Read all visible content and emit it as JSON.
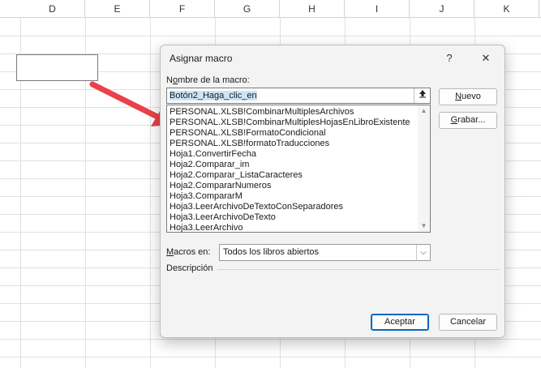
{
  "sheet": {
    "columns": [
      "D",
      "E",
      "F",
      "G",
      "H",
      "I",
      "J",
      "K"
    ]
  },
  "dialog": {
    "title": "Asignar macro",
    "help_glyph": "?",
    "close_glyph": "✕",
    "name_label_pre": "N",
    "name_label_ul": "o",
    "name_label_post": "mbre de la macro:",
    "name_value": "Botón2_Haga_clic_en",
    "macros": [
      "PERSONAL.XLSB!CombinarMultiplesArchivos",
      "PERSONAL.XLSB!CombinarMultiplesHojasEnLibroExistente",
      "PERSONAL.XLSB!FormatoCondicional",
      "PERSONAL.XLSB!formatoTraducciones",
      "Hoja1.ConvertirFecha",
      "Hoja2.Comparar_im",
      "Hoja2.Comparar_ListaCaracteres",
      "Hoja2.CompararNumeros",
      "Hoja3.CompararM",
      "Hoja3.LeerArchivoDeTextoConSeparadores",
      "Hoja3.LeerArchivoDeTexto",
      "Hoja3.LeerArchivo"
    ],
    "new_button_ul": "N",
    "new_button_post": "uevo",
    "record_button_ul": "G",
    "record_button_post": "rabar...",
    "macros_in_label_ul": "M",
    "macros_in_label_post": "acros en:",
    "macros_in_value": "Todos los libros abiertos",
    "description_label": "Descripción",
    "accept_button": "Aceptar",
    "cancel_button": "Cancelar"
  },
  "colors": {
    "accent": "#0067c0",
    "arrow": "#e8424a"
  }
}
